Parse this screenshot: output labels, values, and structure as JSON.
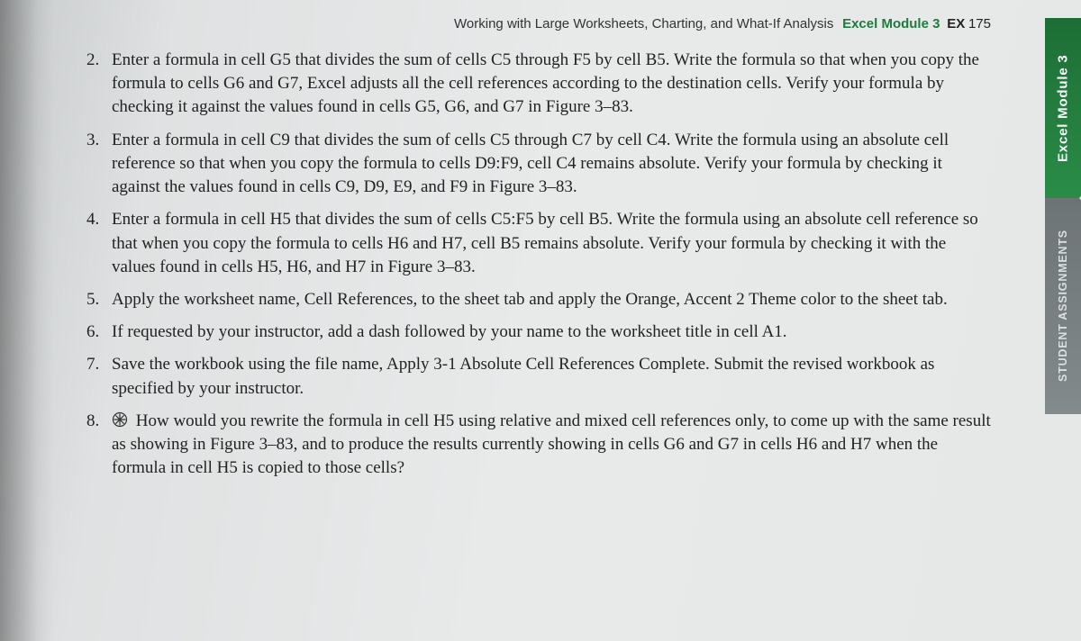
{
  "header": {
    "title": "Working with Large Worksheets, Charting, and What-If Analysis",
    "module": "Excel Module 3",
    "page_label": "EX",
    "page_number": "175"
  },
  "side_tab": {
    "top": "Excel Module 3",
    "bottom": "STUDENT ASSIGNMENTS"
  },
  "items": {
    "i2": "Enter a formula in cell G5 that divides the sum of cells C5 through F5 by cell B5. Write the formula so that when you copy the formula to cells G6 and G7, Excel adjusts all the cell references according to the destination cells. Verify your formula by checking it against the values found in cells G5, G6, and G7 in Figure 3–83.",
    "i3": "Enter a formula in cell C9 that divides the sum of cells C5 through C7 by cell C4. Write the formula using an absolute cell reference so that when you copy the formula to cells D9:F9, cell C4 remains absolute. Verify your formula by checking it against the values found in cells C9, D9, E9, and F9 in Figure 3–83.",
    "i4": "Enter a formula in cell H5 that divides the sum of cells C5:F5 by cell B5. Write the formula using an absolute cell reference so that when you copy the formula to cells H6 and H7, cell B5 remains absolute. Verify your formula by checking it with the values found in cells H5, H6, and H7 in Figure 3–83.",
    "i5": "Apply the worksheet name, Cell References, to the sheet tab and apply the Orange, Accent 2 Theme color to the sheet tab.",
    "i6": "If requested by your instructor, add a dash followed by your name to the worksheet title in cell A1.",
    "i7": "Save the workbook using the file name, Apply 3-1 Absolute Cell References Complete. Submit the revised workbook as specified by your instructor.",
    "i8": "How would you rewrite the formula in cell H5 using relative and mixed cell references only, to come up with the same result as showing in Figure 3–83, and to produce the results currently showing in cells G6 and G7 in cells H6 and H7 when the formula in cell H5 is copied to those cells?"
  }
}
